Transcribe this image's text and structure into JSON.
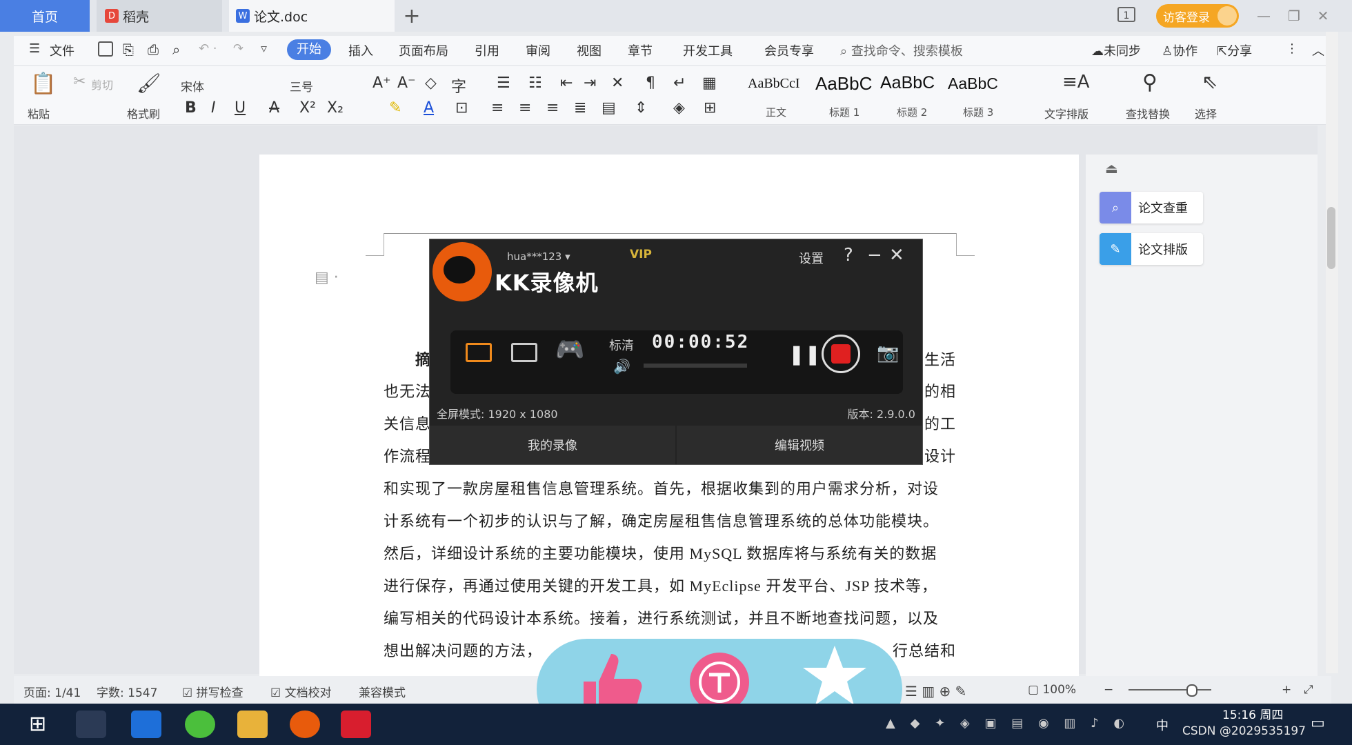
{
  "tabs": {
    "home": "首页",
    "daoke": "稻壳",
    "doc": "论文.doc",
    "add": "+"
  },
  "title_bar": {
    "page_indicator": "1",
    "guest_login": "访客登录"
  },
  "menu": {
    "file": "文件",
    "items": [
      "开始",
      "插入",
      "页面布局",
      "引用",
      "审阅",
      "视图",
      "章节",
      "开发工具",
      "会员专享"
    ],
    "search_placeholder": "查找命令、搜索模板",
    "sync": "未同步",
    "collab": "协作",
    "share": "分享"
  },
  "toolbar": {
    "paste": "粘贴",
    "cut": "剪切",
    "format_painter": "格式刷",
    "font_name": "宋体",
    "font_size": "三号",
    "styles": [
      {
        "sample": "AaBbCcI",
        "label": "正文"
      },
      {
        "sample": "AaBbC",
        "label": "标题 1"
      },
      {
        "sample": "AaBbC",
        "label": "标题 2"
      },
      {
        "sample": "AaBbC",
        "label": "标题 3"
      }
    ],
    "text_layout": "文字排版",
    "find_replace": "查找替换",
    "select": "选择"
  },
  "document": {
    "lines": [
      "摘",
      "也无法",
      "关信息",
      "作流程",
      "和实现了一款房屋租售信息管理系统。首先，根据收集到的用户需求分析，对设",
      "计系统有一个初步的认识与了解，确定房屋租售信息管理系统的总体功能模块。",
      "然后，详细设计系统的主要功能模块，使用 MySQL 数据库将与系统有关的数据",
      "进行保存，再通过使用关键的开发工具，如 MyEclipse 开发平台、JSP 技术等，",
      "编写相关的代码设计本系统。接着，进行系统测试，并且不断地查找问题，以及",
      "想出解决问题的方法，"
    ],
    "right_fragments": [
      "生活",
      "的相",
      "的工",
      "设计",
      "行总结和"
    ]
  },
  "right_panel": {
    "check": "论文查重",
    "format": "论文排版"
  },
  "kk": {
    "user": "hua***123",
    "vip": "VIP",
    "settings": "设置",
    "help": "?",
    "title": "KK录像机",
    "quality": "标清",
    "timer": "00:00:52",
    "mode": "全屏模式: 1920 x 1080",
    "version": "版本: 2.9.0.0",
    "my_recordings": "我的录像",
    "edit_video": "编辑视频"
  },
  "statusbar": {
    "page": "页面: 1/41",
    "words": "字数: 1547",
    "spell": "拼写检查",
    "proof": "文档校对",
    "compat": "兼容模式",
    "zoom": "100%"
  },
  "taskbar": {
    "time": "15:16 周四",
    "ime": "中",
    "watermark": "CSDN @2029535197"
  },
  "colors": {
    "accent": "#4a7fe3",
    "guest": "#f5a623",
    "record_red": "#e02020",
    "reaction_bg": "#8fd4e8",
    "reaction_pink": "#ef5b8c"
  }
}
